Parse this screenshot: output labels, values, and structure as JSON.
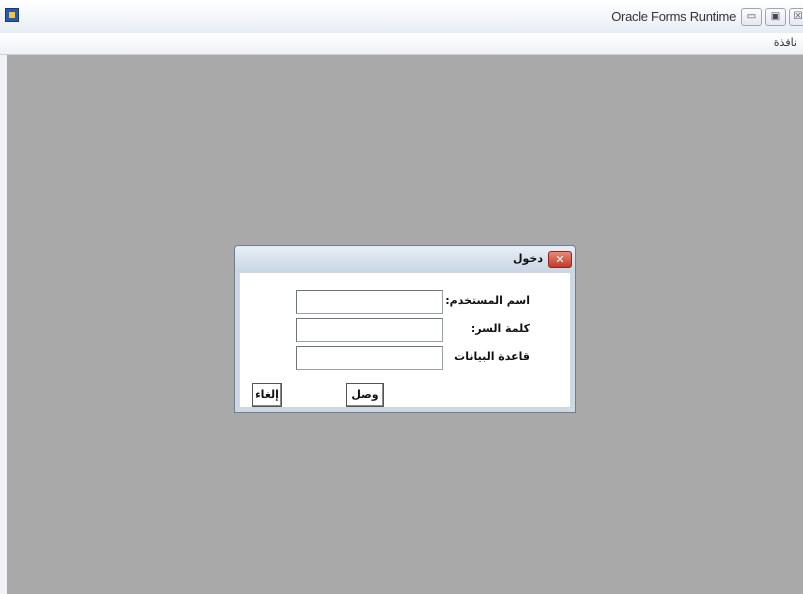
{
  "window": {
    "title": "Oracle Forms Runtime",
    "app_icon": "oracle-forms-app-icon",
    "controls": {
      "minimize_glyph": "▭",
      "maximize_glyph": "▣",
      "close_glyph": "☒"
    }
  },
  "menubar": {
    "items": [
      {
        "label": "نافذة"
      }
    ]
  },
  "dialog": {
    "title": "دخول",
    "close_glyph": "✕",
    "fields": [
      {
        "label": "اسم المستخدم:",
        "value": ""
      },
      {
        "label": "كلمة السر:",
        "value": ""
      },
      {
        "label": "قاعدة البيانات",
        "value": ""
      }
    ],
    "buttons": {
      "connect": "وصل",
      "cancel": "إلغاء"
    }
  },
  "colors": {
    "mdi_background": "#a9a9a9",
    "dialog_close": "#c23a28",
    "titlebar": "#f3f6fa"
  }
}
